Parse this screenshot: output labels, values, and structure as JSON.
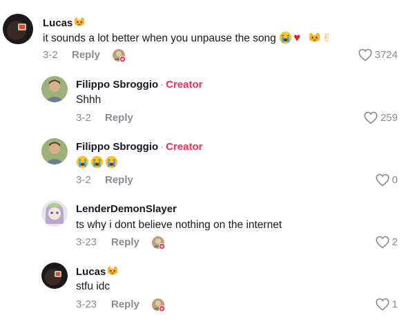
{
  "comments": [
    {
      "user": "Lucas",
      "text": "it sounds a lot better when you unpause the song",
      "date": "3-2",
      "reply": "Reply",
      "likes": "3724"
    },
    {
      "user": "Filippo Sbroggio",
      "sep": "·",
      "badge": "Creator",
      "text": "Shhh",
      "date": "3-2",
      "reply": "Reply",
      "likes": "259"
    },
    {
      "user": "Filippo Sbroggio",
      "sep": "·",
      "badge": "Creator",
      "text": "",
      "date": "3-2",
      "reply": "Reply",
      "likes": "0"
    },
    {
      "user": "LenderDemonSlayer",
      "text": "ts why i dont believe nothing on the internet",
      "date": "3-23",
      "reply": "Reply",
      "likes": "2"
    },
    {
      "user": "Lucas",
      "text": "stfu idc",
      "date": "3-23",
      "reply": "Reply",
      "likes": "1"
    }
  ],
  "colors": {
    "creator": "#fe2c55",
    "meta": "#8a8b91",
    "text": "#161823"
  }
}
